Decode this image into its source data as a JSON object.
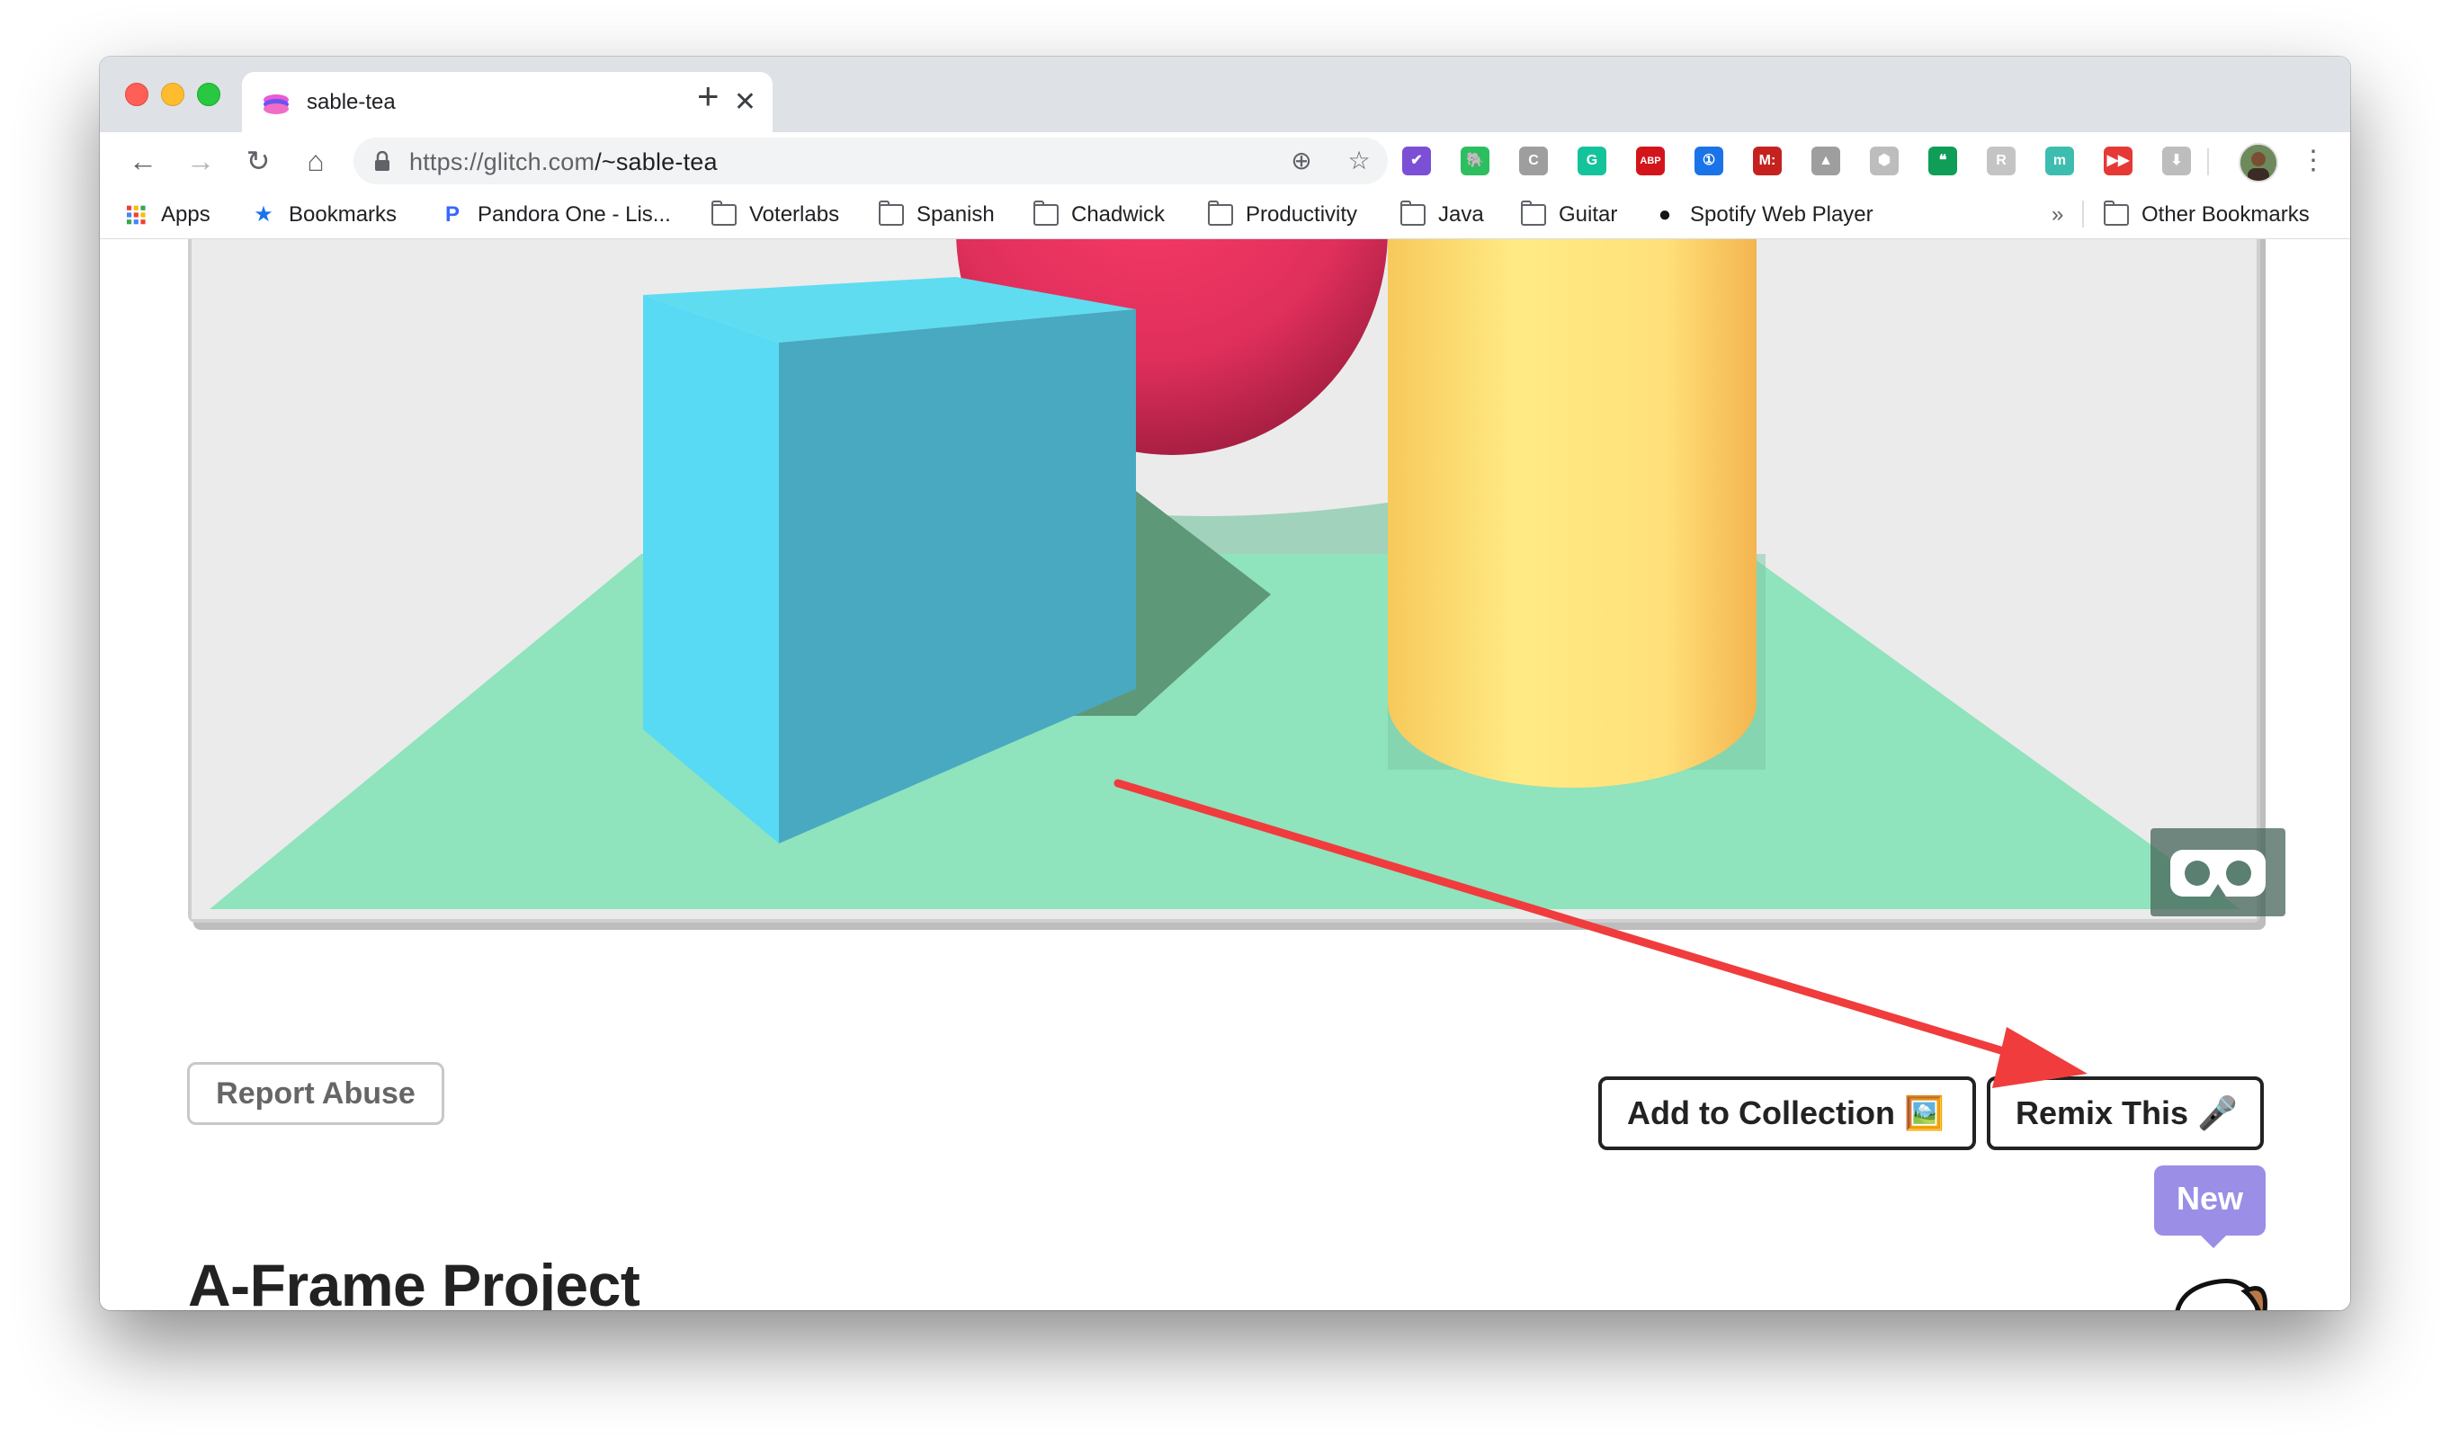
{
  "browser": {
    "tab_title": "sable-tea",
    "new_tab_symbol": "+",
    "url_host": "https://glitch.com",
    "url_path": "/~sable-tea"
  },
  "toolbar": {
    "extensions": [
      {
        "icon": "checkbox-extension-icon",
        "color": "#7b4fd6",
        "glyph": "✔"
      },
      {
        "icon": "evernote-icon",
        "color": "#2dbe60",
        "glyph": "🐘"
      },
      {
        "icon": "calendar-extension-icon",
        "color": "#9e9e9e",
        "glyph": "C"
      },
      {
        "icon": "grammarly-icon",
        "color": "#15c39a",
        "glyph": "G"
      },
      {
        "icon": "adblock-plus-icon",
        "color": "#d3151b",
        "glyph": "ABP"
      },
      {
        "icon": "onepassword-icon",
        "color": "#1a73e8",
        "glyph": "①"
      },
      {
        "icon": "gmail-extension-icon",
        "color": "#c5221f",
        "glyph": "M:"
      },
      {
        "icon": "google-drive-icon",
        "color": "#9e9e9e",
        "glyph": "▲"
      },
      {
        "icon": "cube-extension-icon",
        "color": "#bdbdbd",
        "glyph": "⬢"
      },
      {
        "icon": "hangouts-icon",
        "color": "#0f9d58",
        "glyph": "❝"
      },
      {
        "icon": "r-extension-icon",
        "color": "#c4c4c4",
        "glyph": "R"
      },
      {
        "icon": "m-extension-icon",
        "color": "#3dbdb0",
        "glyph": "m"
      },
      {
        "icon": "youtube-extension-icon",
        "color": "#e53935",
        "glyph": "▶▶"
      },
      {
        "icon": "download-icon",
        "color": "#bdbdbd",
        "glyph": "⬇"
      }
    ]
  },
  "bookmarks": {
    "apps": "Apps",
    "items": [
      {
        "label": "Bookmarks",
        "icon": "star-icon"
      },
      {
        "label": "Pandora One - Lis...",
        "icon": "pandora-icon"
      },
      {
        "label": "Voterlabs",
        "icon": "folder-icon"
      },
      {
        "label": "Spanish",
        "icon": "folder-icon"
      },
      {
        "label": "Chadwick",
        "icon": "folder-icon"
      },
      {
        "label": "Productivity",
        "icon": "folder-icon"
      },
      {
        "label": "Java",
        "icon": "folder-icon"
      },
      {
        "label": "Guitar",
        "icon": "folder-icon"
      },
      {
        "label": "Spotify Web Player",
        "icon": "spotify-icon"
      }
    ],
    "overflow": "»",
    "other": "Other Bookmarks"
  },
  "page": {
    "report_abuse": "Report Abuse",
    "add_to_collection": "Add to Collection 🖼️",
    "remix_this": "Remix This 🎤",
    "new_badge": "New",
    "project_title": "A-Frame Project"
  },
  "colors": {
    "plane": "#8fe3bd",
    "box_front": "#48a9c0",
    "box_side": "#5cdcf2",
    "sphere": "#e3345f",
    "cylinder": "#ffe27a",
    "annotation_arrow": "#f03c3c"
  }
}
